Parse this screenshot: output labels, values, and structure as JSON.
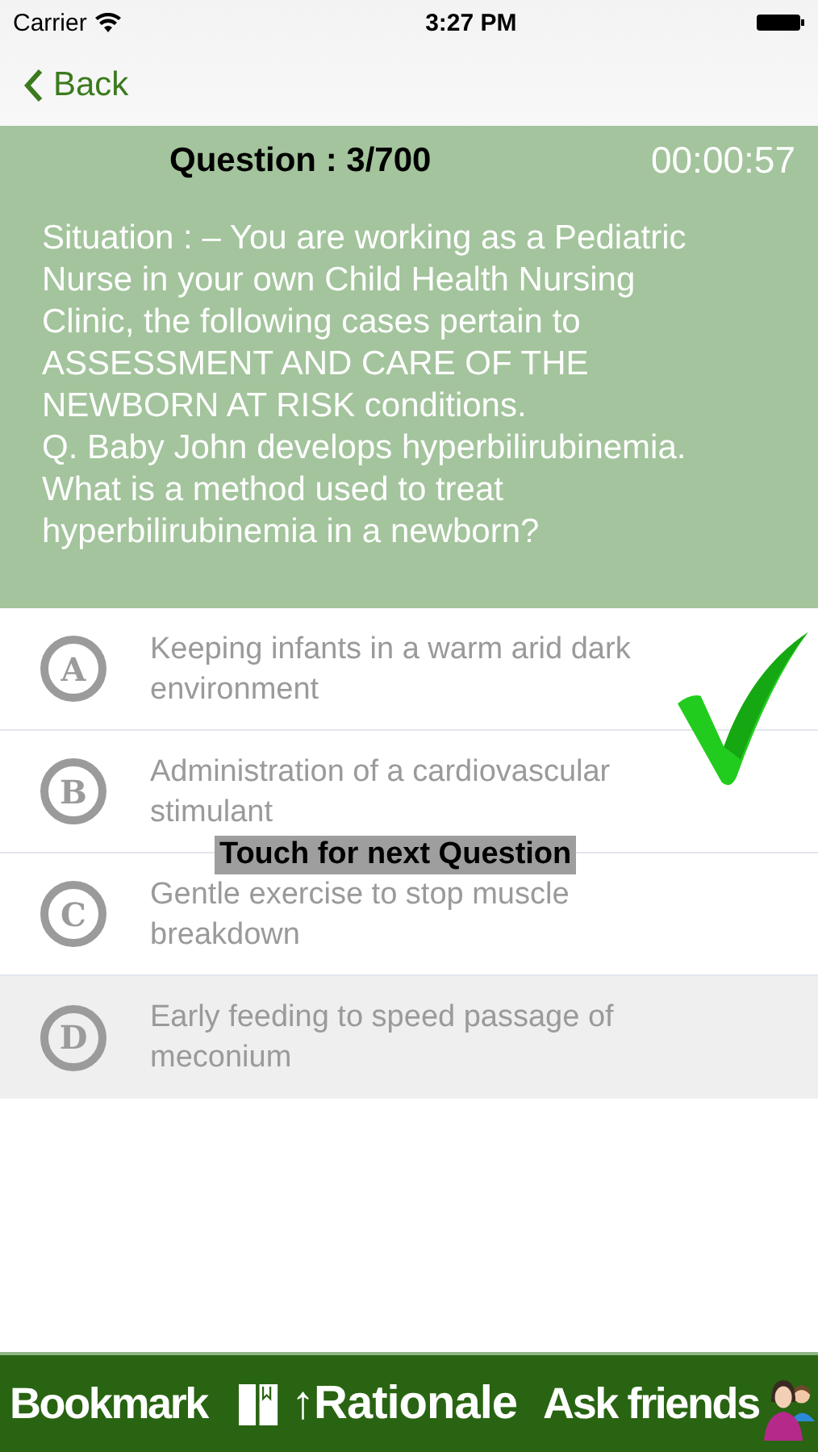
{
  "status_bar": {
    "carrier": "Carrier",
    "time": "3:27 PM"
  },
  "nav": {
    "back": "Back"
  },
  "question": {
    "counter": "Question : 3/700",
    "timer": "00:00:57",
    "text": "Situation : – You are working as a Pediatric Nurse in your own Child Health Nursing Clinic, the following cases pertain to ASSESSMENT AND CARE OF THE NEWBORN AT RISK conditions.\nQ. Baby John develops hyperbilirubinemia. What is a method used to treat hyperbilirubinemia in a newborn?"
  },
  "options": [
    {
      "letter": "A",
      "text": "Keeping infants in a warm arid dark environment",
      "selected": false
    },
    {
      "letter": "B",
      "text": "Administration of a cardiovascular stimulant",
      "selected": false
    },
    {
      "letter": "C",
      "text": "Gentle exercise to stop muscle breakdown",
      "selected": false
    },
    {
      "letter": "D",
      "text": "Early feeding to speed passage of meconium",
      "selected": true
    }
  ],
  "feedback": {
    "correct": true,
    "toast": "Touch for next Question"
  },
  "bottom_bar": {
    "bookmark": "Bookmark",
    "rationale": "↑Rationale",
    "ask_friends": "Ask friends"
  }
}
